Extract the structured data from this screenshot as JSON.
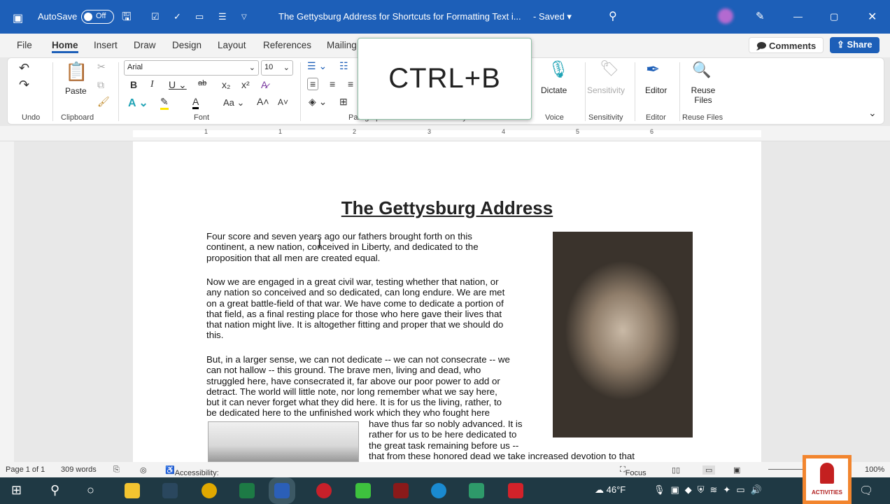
{
  "titlebar": {
    "autosave_label": "AutoSave",
    "autosave_state": "Off",
    "doc_title": "The Gettysburg Address for Shortcuts for Formatting Text i...",
    "saved": "- Saved ▾"
  },
  "tabs": [
    "File",
    "Home",
    "Insert",
    "Draw",
    "Design",
    "Layout",
    "References",
    "Mailing"
  ],
  "actions": {
    "comments": "Comments",
    "share": "Share"
  },
  "ribbon": {
    "font_name": "Arial",
    "font_size": "10",
    "paste": "Paste",
    "dictate": "Dictate",
    "sensitivity": "Sensitivity",
    "editor": "Editor",
    "reuse_files": "Reuse Files",
    "groups": {
      "undo": "Undo",
      "clipboard": "Clipboard",
      "font": "Font",
      "paragraph": "Paragraph",
      "styles": "Styles",
      "voice": "Voice",
      "sensitivity": "Sensitivity",
      "editor": "Editor",
      "reuse_files": "Reuse Files"
    }
  },
  "popup": {
    "shortcut": "CTRL+B"
  },
  "ruler": [
    "1",
    "1",
    "2",
    "3",
    "4",
    "5",
    "6"
  ],
  "document": {
    "title": "The Gettysburg Address",
    "p1": [
      "Four score and seven years ago our fathers brought forth on this",
      "continent, a new nation, conceived in Liberty, and dedicated to the",
      "proposition that all men are created equal."
    ],
    "p2": [
      "Now we are engaged in a great civil war, testing whether that nation, or",
      "any nation so conceived and so dedicated, can long endure. We are met",
      "on a great battle-field of that war. We have come to dedicate a portion of",
      "that field, as a final resting place for those who here gave their lives that",
      "that nation might live. It is altogether fitting and proper that we should do",
      "this."
    ],
    "p3": [
      "But, in a larger sense, we can not dedicate -- we can not consecrate -- we",
      "can not hallow -- this ground. The brave men, living and dead, who",
      "struggled here, have consecrated it, far above our poor power to add or",
      "detract. The world will little note, nor long remember what we say here,",
      "but it can never forget what they did here. It is for us the living, rather, to",
      "be dedicated here to the unfinished work which they who fought here"
    ],
    "p3_wrap": [
      "have thus far so nobly advanced. It is",
      "rather for us to be here dedicated to",
      "the great task remaining before us --",
      "that from these honored dead we take increased devotion to that"
    ]
  },
  "status": {
    "page": "Page 1 of 1",
    "words": "309 words",
    "accessibility": "Accessibility: Investigate",
    "focus": "Focus",
    "zoom": "100%"
  },
  "taskbar": {
    "weather": "46°F"
  },
  "logo": {
    "text": "ACTIVITIES"
  }
}
